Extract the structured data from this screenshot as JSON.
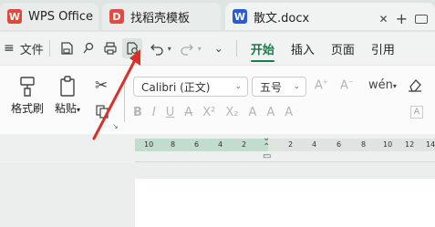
{
  "tabs": [
    {
      "label": "WPS Office",
      "icon": "wps-logo-icon"
    },
    {
      "label": "找稻壳模板",
      "icon": "docer-icon"
    },
    {
      "label": "散文.docx",
      "icon": "word-doc-icon"
    }
  ],
  "menu": {
    "file_label": "文件",
    "ribbon_tabs": [
      "开始",
      "插入",
      "页面",
      "引用"
    ],
    "active_tab": "开始"
  },
  "ribbon": {
    "format_painter": "格式刷",
    "paste": "粘贴",
    "font_name": "Calibri (正文)",
    "font_size": "五号",
    "format_buttons": [
      "B",
      "I",
      "U",
      "A",
      "X²",
      "X₂",
      "A",
      "A",
      "A"
    ]
  },
  "ruler": {
    "left_ticks": [
      "10",
      "8",
      "6",
      "4",
      "2"
    ],
    "right_ticks": [
      "2",
      "4",
      "6",
      "8",
      "10",
      "12",
      "14"
    ]
  },
  "colors": {
    "accent_green": "#1c7a4e",
    "annotation_arrow": "#d9302b"
  }
}
